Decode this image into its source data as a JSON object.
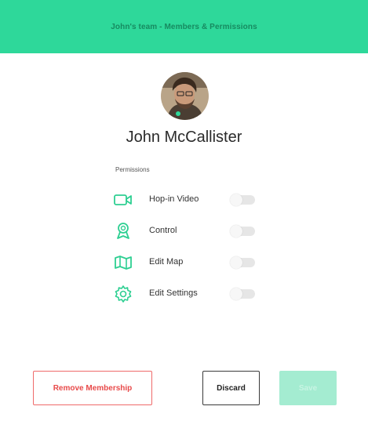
{
  "header": {
    "title": "John's team - Members & Permissions"
  },
  "user": {
    "name": "John McCallister"
  },
  "permissions": {
    "heading": "Permissions",
    "items": [
      {
        "label": "Hop-in Video",
        "icon": "video-camera-icon",
        "enabled": false
      },
      {
        "label": "Control",
        "icon": "award-badge-icon",
        "enabled": false
      },
      {
        "label": "Edit Map",
        "icon": "map-icon",
        "enabled": false
      },
      {
        "label": "Edit Settings",
        "icon": "gear-icon",
        "enabled": false
      }
    ]
  },
  "actions": {
    "remove_label": "Remove Membership",
    "discard_label": "Discard",
    "save_label": "Save",
    "save_enabled": false
  },
  "colors": {
    "accent": "#2ed89a",
    "header_text": "#178a60",
    "danger": "#e84a4a",
    "icon": "#2ecf92",
    "save_disabled": "#a4ecd1"
  }
}
